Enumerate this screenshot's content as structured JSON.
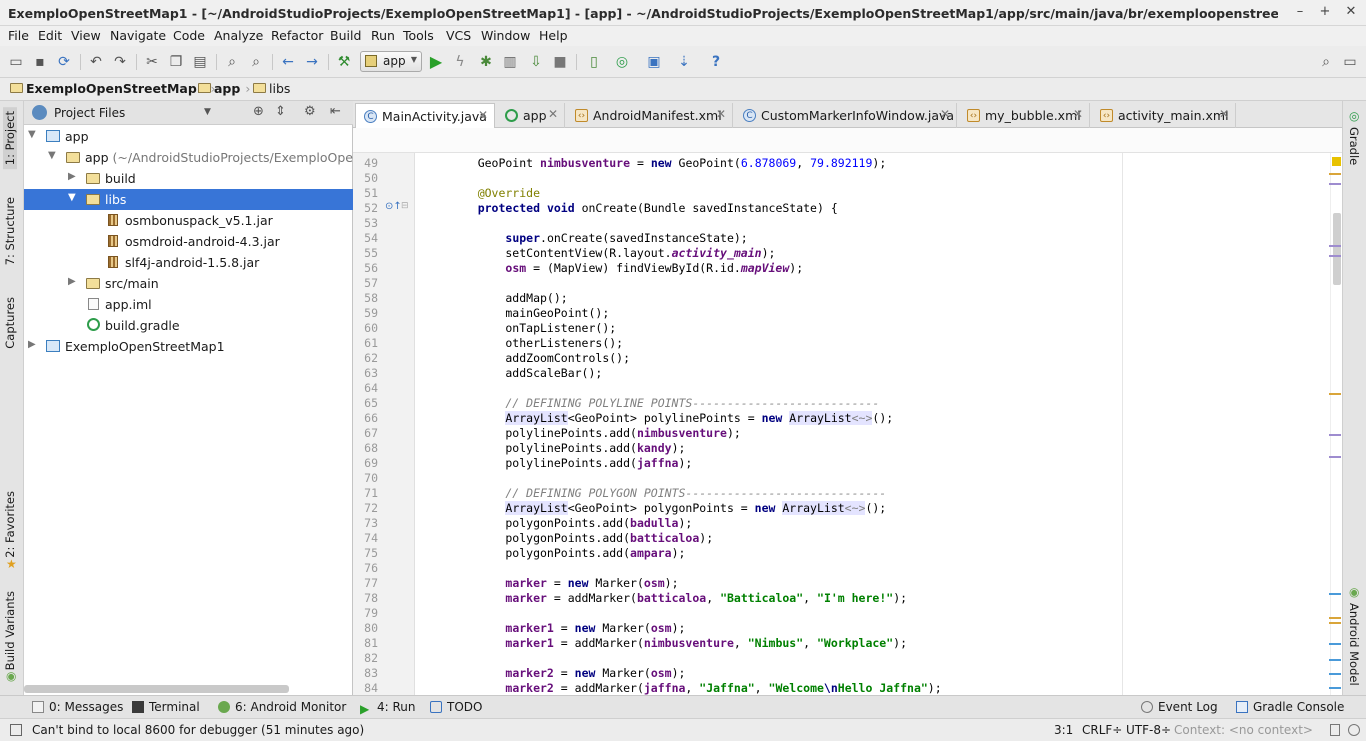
{
  "window": {
    "title": "ExemploOpenStreetMap1 - [~/AndroidStudioProjects/ExemploOpenStreetMap1] - [app] - ~/AndroidStudioProjects/ExemploOpenStreetMap1/app/src/main/java/br/exemploopenstreetmap/MainAct...",
    "minimize": "–",
    "maximize": "+",
    "close": "✕"
  },
  "menu": [
    "File",
    "Edit",
    "View",
    "Navigate",
    "Code",
    "Analyze",
    "Refactor",
    "Build",
    "Run",
    "Tools",
    "VCS",
    "Window",
    "Help"
  ],
  "toolbar": {
    "run_config": "app",
    "help": "?"
  },
  "breadcrumb": [
    "ExemploOpenStreetMap1",
    "app",
    "libs"
  ],
  "left_strip": {
    "project": "1: Project",
    "structure": "7: Structure",
    "captures": "Captures",
    "favorites": "2: Favorites",
    "build_variants": "Build Variants"
  },
  "right_strip": {
    "gradle": "Gradle",
    "android_model": "Android Model"
  },
  "project_panel": {
    "view_mode": "Project Files",
    "tree": [
      {
        "label": "app",
        "extra": "",
        "type": "module"
      },
      {
        "label": "app",
        "extra": " (~/AndroidStudioProjects/ExemploOpenStre",
        "type": "folder"
      },
      {
        "label": "build",
        "extra": "",
        "type": "folder"
      },
      {
        "label": "libs",
        "extra": "",
        "type": "folder"
      },
      {
        "label": "osmbonuspack_v5.1.jar",
        "extra": "",
        "type": "jar"
      },
      {
        "label": "osmdroid-android-4.3.jar",
        "extra": "",
        "type": "jar"
      },
      {
        "label": "slf4j-android-1.5.8.jar",
        "extra": "",
        "type": "jar"
      },
      {
        "label": "src/main",
        "extra": "",
        "type": "folder"
      },
      {
        "label": "app.iml",
        "extra": "",
        "type": "file"
      },
      {
        "label": "build.gradle",
        "extra": "",
        "type": "gradle"
      },
      {
        "label": "ExemploOpenStreetMap1",
        "extra": "",
        "type": "module"
      }
    ]
  },
  "editor_tabs": [
    {
      "label": "MainActivity.java",
      "active": true
    },
    {
      "label": "app",
      "active": false
    },
    {
      "label": "AndroidManifest.xml",
      "active": false
    },
    {
      "label": "CustomMarkerInfoWindow.java",
      "active": false
    },
    {
      "label": "my_bubble.xml",
      "active": false
    },
    {
      "label": "activity_main.xml",
      "active": false
    }
  ],
  "code": {
    "line_numbers": [
      "49",
      "50",
      "51",
      "52",
      "53",
      "54",
      "55",
      "56",
      "57",
      "58",
      "59",
      "60",
      "61",
      "62",
      "63",
      "64",
      "65",
      "66",
      "67",
      "68",
      "69",
      "70",
      "71",
      "72",
      "73",
      "74",
      "75",
      "76",
      "77",
      "78",
      "79",
      "80",
      "81",
      "82",
      "83",
      "84"
    ],
    "lines": [
      "    GeoPoint nimbusventure = new GeoPoint(6.878069, 79.892119);",
      "",
      "    @Override",
      "    protected void onCreate(Bundle savedInstanceState) {",
      "",
      "        super.onCreate(savedInstanceState);",
      "        setContentView(R.layout.activity_main);",
      "        osm = (MapView) findViewById(R.id.mapView);",
      "",
      "        addMap();",
      "        mainGeoPoint();",
      "        onTapListener();",
      "        otherListeners();",
      "        addZoomControls();",
      "        addScaleBar();",
      "",
      "        // DEFINING POLYLINE POINTS---------------------------",
      "        ArrayList<GeoPoint> polylinePoints = new ArrayList<~>();",
      "        polylinePoints.add(nimbusventure);",
      "        polylinePoints.add(kandy);",
      "        polylinePoints.add(jaffna);",
      "",
      "        // DEFINING POLYGON POINTS-----------------------------",
      "        ArrayList<GeoPoint> polygonPoints = new ArrayList<~>();",
      "        polygonPoints.add(badulla);",
      "        polygonPoints.add(batticaloa);",
      "        polygonPoints.add(ampara);",
      "",
      "        marker = new Marker(osm);",
      "        marker = addMarker(batticaloa, \"Batticaloa\", \"I'm here!\");",
      "",
      "        marker1 = new Marker(osm);",
      "        marker1 = addMarker(nimbusventure, \"Nimbus\", \"Workplace\");",
      "",
      "        marker2 = new Marker(osm);",
      "        marker2 = addMarker(jaffna, \"Jaffna\", \"Welcome\\nHello Jaffna\");"
    ]
  },
  "bottom_tabs": [
    {
      "label": "0: Messages"
    },
    {
      "label": "Terminal"
    },
    {
      "label": "6: Android Monitor"
    },
    {
      "label": "4: Run"
    },
    {
      "label": "TODO"
    },
    {
      "label": "Event Log"
    },
    {
      "label": "Gradle Console"
    }
  ],
  "status": {
    "message": "Can't bind to local 8600 for debugger (51 minutes ago)",
    "position": "3:1",
    "line_sep": "CRLF÷",
    "encoding": "UTF-8÷",
    "context": "Context: <no context>"
  },
  "colors": {
    "selection": "#3875d7",
    "keyword": "#000080",
    "string": "#008000",
    "field": "#660e7a",
    "number": "#0000ff",
    "comment": "#808080"
  }
}
